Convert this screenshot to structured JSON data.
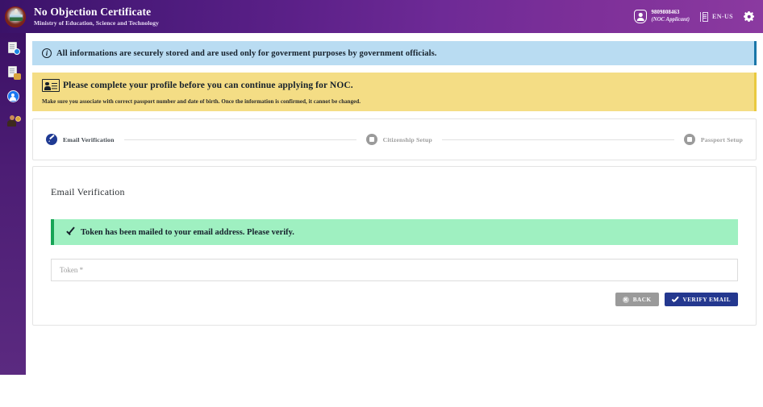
{
  "header": {
    "emblem_icon": "nepal-emblem-icon",
    "title": "No Objection Certificate",
    "subtitle": "Ministry of Education, Science and Technology",
    "user": {
      "icon": "user-shield-icon",
      "phone": "9809808463",
      "role": "(NOC Applicant)"
    },
    "language": {
      "icon": "book-icon",
      "label": "EN-US"
    },
    "settings_icon": "gear-icon"
  },
  "sidebar": {
    "items": [
      {
        "icon": "document-search-icon",
        "name": "sidebar-item-document-search"
      },
      {
        "icon": "document-approval-icon",
        "name": "sidebar-item-document-approval"
      },
      {
        "icon": "user-profile-icon",
        "name": "sidebar-item-user-profile"
      },
      {
        "icon": "user-settings-icon",
        "name": "sidebar-item-user-settings"
      }
    ]
  },
  "banners": {
    "info": {
      "icon": "info-icon",
      "text": "All informations are securely stored and are used only for goverment purposes by government officials.",
      "bg_color": "#b9dcf2",
      "accent_color": "#1976a8"
    },
    "warning": {
      "icon": "id-card-icon",
      "title": "Please complete your profile before you can continue applying for NOC.",
      "subtitle": "Make sure you associate with correct passport number and date of birth. Once the information is confirmed, it cannot be changed.",
      "bg_color": "#f4dd85",
      "accent_color": "#e9c93f"
    }
  },
  "stepper": {
    "steps": [
      {
        "label": "Email Verification",
        "state": "active",
        "icon": "pencil-edit-icon"
      },
      {
        "label": "Citizenship Setup",
        "state": "idle",
        "icon": "card-icon"
      },
      {
        "label": "Passport Setup",
        "state": "idle",
        "icon": "card-icon"
      }
    ],
    "active_color": "#1f3a93",
    "idle_color": "#9b9b9b"
  },
  "card": {
    "title": "Email Verification",
    "success_alert": {
      "icon": "check-icon",
      "text": "Token has been mailed to your email address. Please verify.",
      "bg_color": "#9ff0c1",
      "accent_color": "#17a456"
    },
    "token_input": {
      "placeholder": "Token *",
      "value": ""
    },
    "buttons": {
      "back": {
        "label": "BACK",
        "icon": "close-circle-icon",
        "color": "#9a9a9a"
      },
      "verify": {
        "label": "VERIFY EMAIL",
        "icon": "check-icon",
        "color": "#24388f"
      }
    }
  }
}
